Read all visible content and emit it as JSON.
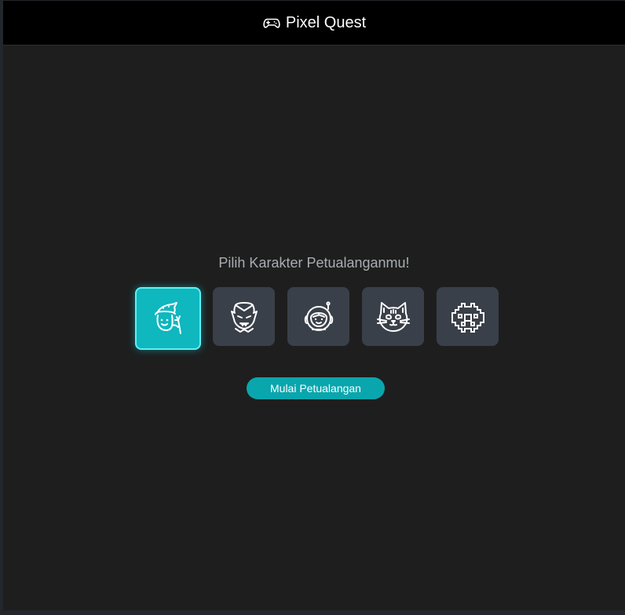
{
  "header": {
    "icon": "gamepad-icon",
    "title": "Pixel Quest"
  },
  "main": {
    "prompt": "Pilih Karakter Petualanganmu!",
    "characters": [
      {
        "icon": "wizard-icon",
        "selected": true
      },
      {
        "icon": "vampire-icon",
        "selected": false
      },
      {
        "icon": "astronaut-icon",
        "selected": false
      },
      {
        "icon": "cat-icon",
        "selected": false
      },
      {
        "icon": "space-invader-icon",
        "selected": false
      }
    ],
    "start_button": "Mulai Petualangan"
  },
  "colors": {
    "accent": "#0aa6ad",
    "selected_border": "#5ef2f4",
    "card": "#3a4049",
    "background": "#1e1e1e",
    "header": "#000000"
  }
}
